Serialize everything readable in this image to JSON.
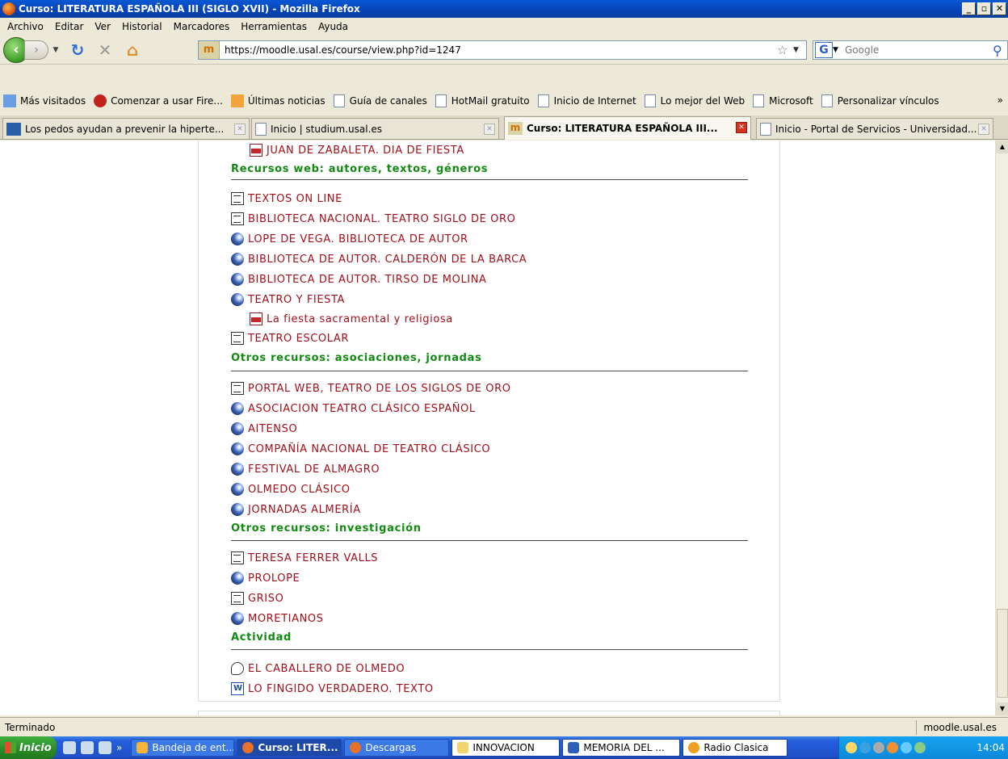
{
  "window": {
    "title": "Curso: LITERATURA ESPAÑOLA III (SIGLO XVII) - Mozilla Firefox"
  },
  "menu": [
    "Archivo",
    "Editar",
    "Ver",
    "Historial",
    "Marcadores",
    "Herramientas",
    "Ayuda"
  ],
  "nav": {
    "url": "https://moodle.usal.es/course/view.php?id=1247",
    "search_placeholder": "Google"
  },
  "bookmarks": [
    "Más visitados",
    "Comenzar a usar Fire...",
    "Últimas noticias",
    "Guía de canales",
    "HotMail gratuito",
    "Inicio de Internet",
    "Lo mejor del Web",
    "Microsoft",
    "Personalizar vínculos"
  ],
  "tabs": [
    {
      "label": "Los pedos ayudan a prevenir la hiperte..."
    },
    {
      "label": "Inicio | studium.usal.es"
    },
    {
      "label": "Curso: LITERATURA ESPAÑOLA III..."
    },
    {
      "label": "Inicio - Portal de Servicios - Universidad..."
    }
  ],
  "course": {
    "top_item": "JUAN DE ZABALETA. DIA DE FIESTA",
    "sections": [
      {
        "title": "Recursos web: autores, textos, géneros"
      },
      {
        "title": "Otros recursos: asociaciones, jornadas"
      },
      {
        "title": "Otros recursos: investigación"
      },
      {
        "title": "Actividad"
      }
    ],
    "web": [
      {
        "label": "TEXTOS ON LINE",
        "icon": "doc"
      },
      {
        "label": "BIBLIOTECA NACIONAL. TEATRO SIGLO DE ORO",
        "icon": "doc"
      },
      {
        "label": "LOPE DE VEGA. BIBLIOTECA DE AUTOR",
        "icon": "globe"
      },
      {
        "label": "BIBLIOTECA DE AUTOR. CALDERÓN DE LA BARCA",
        "icon": "globe"
      },
      {
        "label": "BIBLIOTECA DE AUTOR. TIRSO DE MOLINA",
        "icon": "globe"
      },
      {
        "label": "TEATRO Y FIESTA",
        "icon": "globe"
      },
      {
        "label": "La fiesta sacramental y religiosa",
        "icon": "pdf"
      },
      {
        "label": "TEATRO ESCOLAR",
        "icon": "doc"
      }
    ],
    "assoc": [
      {
        "label": "PORTAL WEB, TEATRO DE LOS SIGLOS DE ORO",
        "icon": "doc"
      },
      {
        "label": "ASOCIACION TEATRO CLÁSICO ESPAÑOL",
        "icon": "globe"
      },
      {
        "label": "AITENSO",
        "icon": "globe"
      },
      {
        "label": "COMPAÑÍA NACIONAL DE TEATRO CLÁSICO",
        "icon": "globe"
      },
      {
        "label": "FESTIVAL DE ALMAGRO",
        "icon": "globe"
      },
      {
        "label": "OLMEDO CLÁSICO",
        "icon": "globe"
      },
      {
        "label": "JORNADAS ALMERÍA",
        "icon": "globe"
      }
    ],
    "research": [
      {
        "label": "TERESA FERRER VALLS",
        "icon": "doc"
      },
      {
        "label": "PROLOPE",
        "icon": "globe"
      },
      {
        "label": "GRISO",
        "icon": "doc"
      },
      {
        "label": "MORETIANOS",
        "icon": "globe"
      }
    ],
    "activity": [
      {
        "label": "EL CABALLERO DE OLMEDO",
        "icon": "forum"
      },
      {
        "label": "LO FINGIDO VERDADERO. TEXTO",
        "icon": "word"
      }
    ]
  },
  "status": {
    "text": "Terminado",
    "domain": "moodle.usal.es"
  },
  "taskbar": {
    "start": "Inicio",
    "tasks": [
      "Bandeja de ent...",
      "Curso: LITER...",
      "Descargas",
      "INNOVACION",
      "MEMORIA DEL ...",
      "Radio Clasica"
    ],
    "clock": "14:04"
  }
}
